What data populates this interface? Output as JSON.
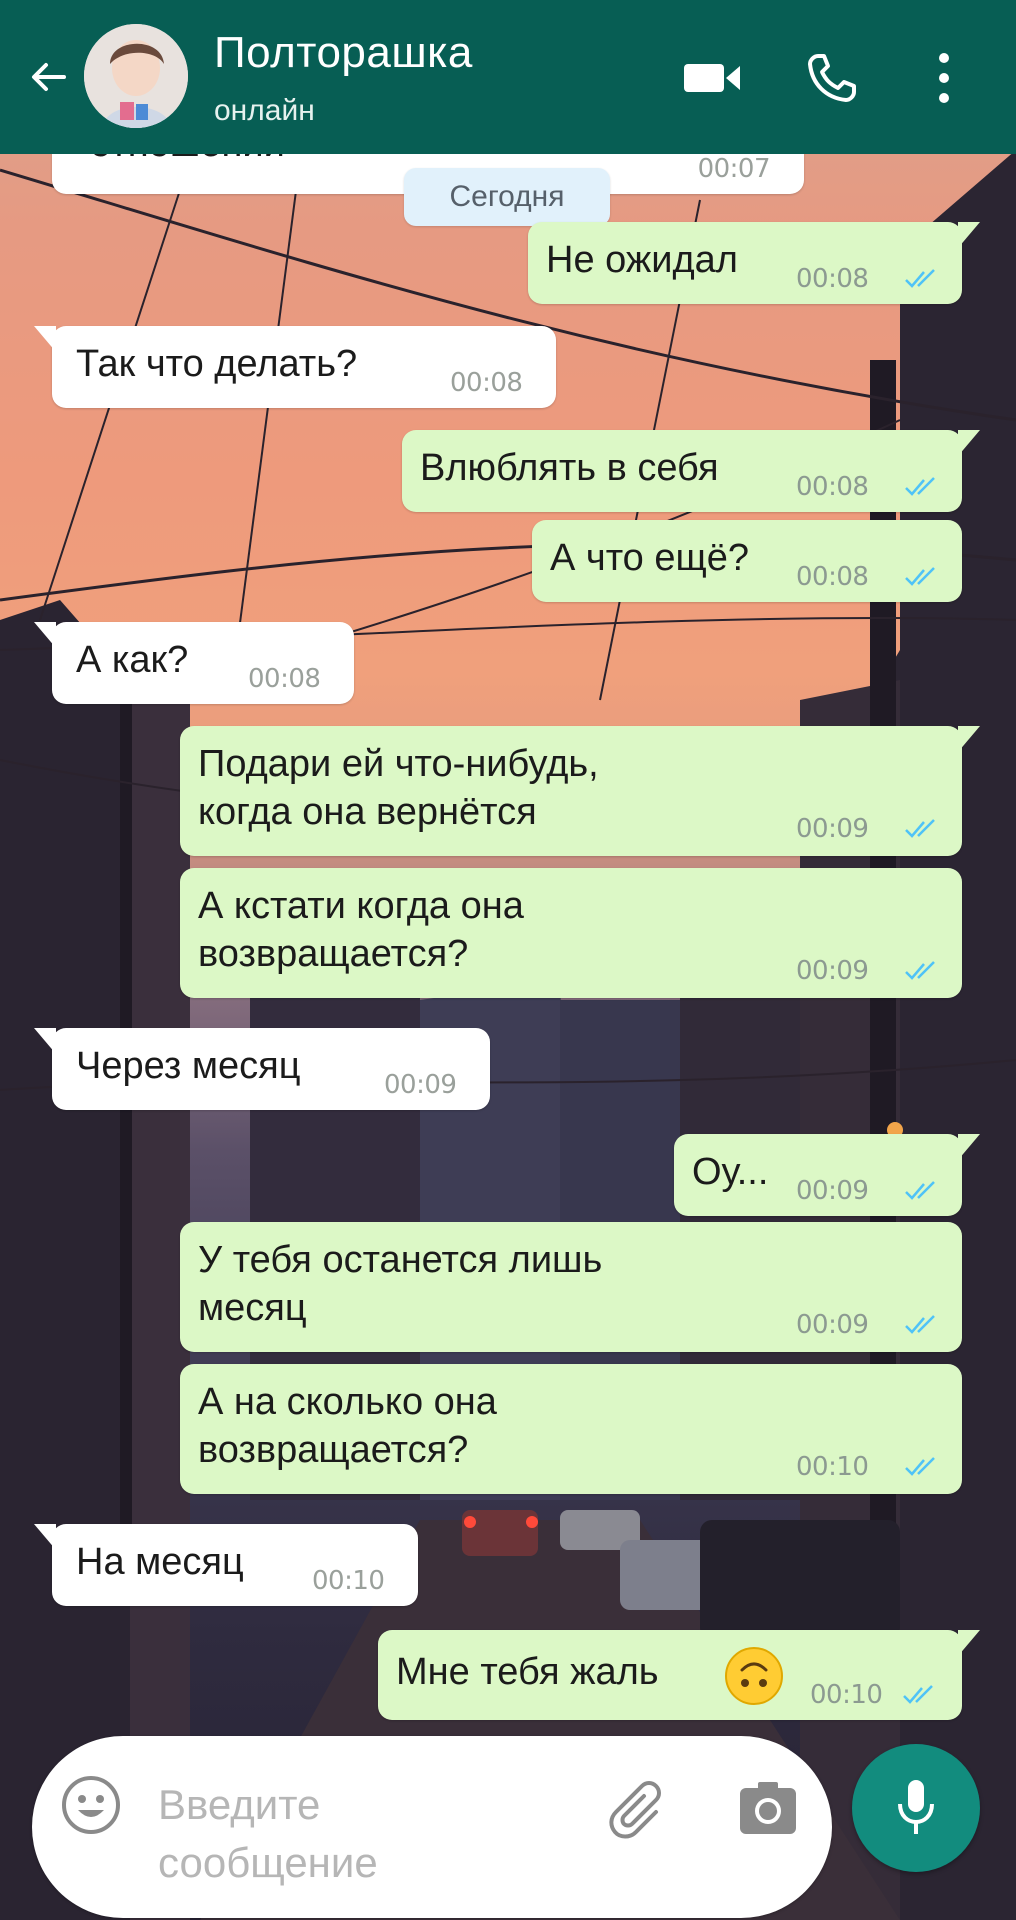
{
  "header": {
    "name": "Полторашка",
    "status": "онлайн",
    "color": "#075e54"
  },
  "chat": {
    "partial_top": {
      "text": "отношений",
      "time": "00:07"
    },
    "date_chip": "Сегодня",
    "messages": [
      {
        "dir": "out",
        "text": "Не ожидал",
        "time": "00:08",
        "read": true
      },
      {
        "dir": "in",
        "text": "Так что делать?",
        "time": "00:08"
      },
      {
        "dir": "out",
        "text": "Влюблять в себя",
        "time": "00:08",
        "read": true
      },
      {
        "dir": "out",
        "text": "А что ещё?",
        "time": "00:08",
        "read": true
      },
      {
        "dir": "in",
        "text": "А как?",
        "time": "00:08"
      },
      {
        "dir": "out",
        "text": "Подари ей что-нибудь,\nкогда она вернётся",
        "time": "00:09",
        "read": true
      },
      {
        "dir": "out",
        "text": "А кстати когда она\nвозвращается?",
        "time": "00:09",
        "read": true
      },
      {
        "dir": "in",
        "text": "Через месяц",
        "time": "00:09"
      },
      {
        "dir": "out",
        "text": "Оу...",
        "time": "00:09",
        "read": true
      },
      {
        "dir": "out",
        "text": "У тебя останется лишь\nмесяц",
        "time": "00:09",
        "read": true
      },
      {
        "dir": "out",
        "text": "А на сколько она\nвозвращается?",
        "time": "00:10",
        "read": true
      },
      {
        "dir": "in",
        "text": "На месяц",
        "time": "00:10"
      },
      {
        "dir": "out",
        "text": "Мне тебя жаль",
        "emoji": "upside-down-face",
        "time": "00:10",
        "read": true
      }
    ],
    "colors": {
      "incoming": "#ffffff",
      "outgoing": "#dcf8c6",
      "ticks": "#4fc3f7"
    }
  },
  "composer": {
    "placeholder": "Введите\nсообщение"
  },
  "icons": {
    "back": "back-arrow-icon",
    "video": "video-call-icon",
    "call": "phone-icon",
    "menu": "more-vert-icon",
    "emoji": "emoji-icon",
    "attach": "paperclip-icon",
    "camera": "camera-icon",
    "mic": "microphone-icon"
  }
}
